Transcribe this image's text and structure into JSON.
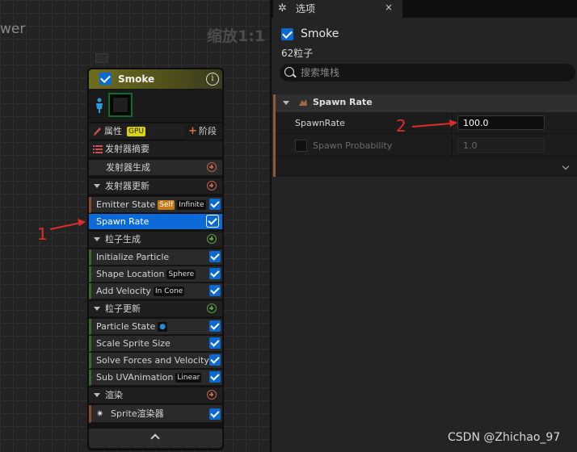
{
  "graph": {
    "title": "wer",
    "zoom": "缩放1:1"
  },
  "node": {
    "title": "Smoke",
    "rows": {
      "properties": {
        "label": "属性",
        "badge": "GPU",
        "stage_label": "阶段"
      },
      "emitter_summary": "发射器摘要",
      "emitter_spawn": "发射器生成",
      "emitter_update": "发射器更新",
      "emitter_state": {
        "label": "Emitter State",
        "badge1": "Self",
        "badge2": "Infinite"
      },
      "spawn_rate": "Spawn Rate",
      "particle_spawn": "粒子生成",
      "initialize_particle": "Initialize Particle",
      "shape_location": {
        "label": "Shape Location",
        "badge": "Sphere"
      },
      "add_velocity": {
        "label": "Add Velocity",
        "badge": "In Cone"
      },
      "particle_update": "粒子更新",
      "particle_state": "Particle State",
      "scale_sprite_size": "Scale Sprite Size",
      "solve_forces": "Solve Forces and Velocity",
      "sub_uv": {
        "label": "Sub UVAnimation",
        "badge": "Linear"
      },
      "render": "渲染",
      "sprite_renderer": "Sprite渲染器"
    }
  },
  "annotations": {
    "one": "1",
    "two": "2"
  },
  "panel": {
    "tab_label": "选项",
    "tab_close": "×",
    "emitter_name": "Smoke",
    "particle_count": "62粒子",
    "search_placeholder": "搜索堆栈",
    "section_title": "Spawn Rate",
    "props": {
      "spawn_rate": {
        "name": "SpawnRate",
        "value": "100.0"
      },
      "spawn_probability": {
        "name": "Spawn Probability",
        "value": "1.0"
      }
    }
  },
  "watermark": "CSDN @Zhichao_97"
}
